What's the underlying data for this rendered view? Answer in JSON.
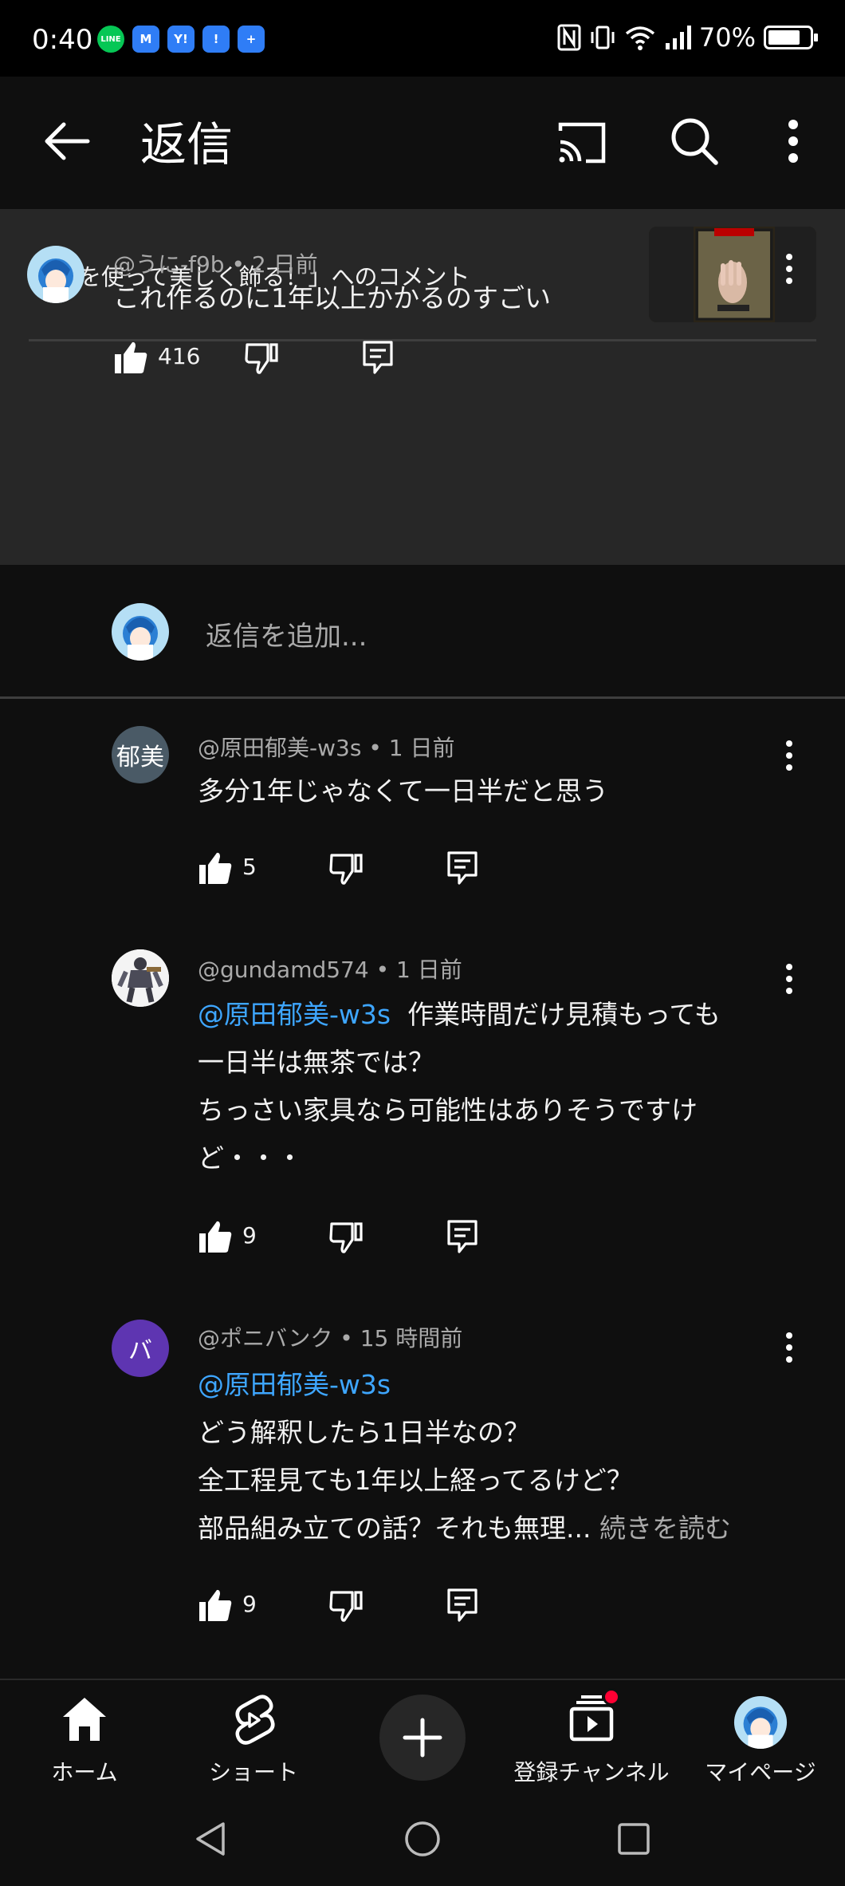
{
  "status_bar": {
    "time": "0:40",
    "apps": [
      {
        "icon": "line-icon",
        "label": "LINE",
        "color": "#06c755"
      },
      {
        "icon": "mail-icon",
        "label": "M",
        "color": "#2f7df6"
      },
      {
        "icon": "yahoo-icon",
        "label": "Y!",
        "color": "#2f7df6"
      },
      {
        "icon": "alert-icon",
        "label": "!",
        "color": "#2f7df6"
      },
      {
        "icon": "calendar-icon",
        "label": "+",
        "color": "#2f7df6"
      }
    ],
    "battery_text": "70%",
    "battery_level": 0.7
  },
  "app_bar": {
    "title": "返信"
  },
  "video": {
    "comment_on": "「骨を使って美しく飾る！」へのコメント"
  },
  "parent_comment": {
    "author": "@うに-f9b",
    "age": "2 日前",
    "text": "これ作るのに1年以上かかるのすごい",
    "likes": "416"
  },
  "add_reply": {
    "placeholder": "返信を追加..."
  },
  "replies": [
    {
      "author": "@原田郁美-w3s",
      "age": "1 日前",
      "avatar_text": "郁美",
      "avatar_color": "#4a5a66",
      "lines": [
        "多分1年じゃなくて一日半だと思う"
      ],
      "likes": "5"
    },
    {
      "author": "@gundamd574",
      "age": "1 日前",
      "mention": "@原田郁美-w3s",
      "line1_rest": "作業時間だけ見積もっても",
      "line2": "一日半は無茶では？",
      "line3": "ちっさい家具なら可能性はありそうですけ",
      "line4": "ど・・・",
      "likes": "9"
    },
    {
      "author": "@ポニバンク",
      "age": "15 時間前",
      "avatar_text": "バ",
      "avatar_color": "#5e35b1",
      "mention": "@原田郁美-w3s",
      "line2": "どう解釈したら1日半なの？",
      "line3": "全工程見ても1年以上経ってるけど？",
      "line4": "部品組み立ての話？それも無理...",
      "read_more": "続きを読む",
      "likes": "9"
    }
  ],
  "bottom_nav": {
    "home": "ホーム",
    "shorts": "ショート",
    "subscriptions": "登録チャンネル",
    "mypage": "マイページ"
  }
}
